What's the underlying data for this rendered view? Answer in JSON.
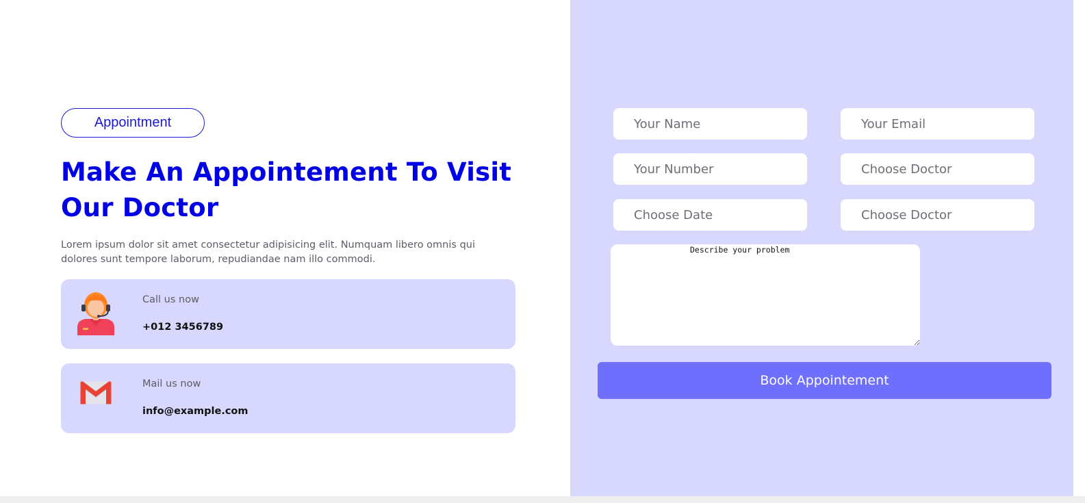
{
  "section_label": "Appointment",
  "heading": "Make An Appointement To Visit Our Doctor",
  "description": "Lorem ipsum dolor sit amet consectetur adipisicing elit. Numquam libero omnis qui dolores sunt tempore laborum, repudiandae nam illo commodi.",
  "contacts": {
    "call": {
      "icon": "support-agent-icon",
      "label": "Call us now",
      "value": "+012 3456789"
    },
    "mail": {
      "icon": "gmail-icon",
      "label": "Mail us now",
      "value": "info@example.com"
    }
  },
  "form": {
    "name_placeholder": "Your Name",
    "email_placeholder": "Your Email",
    "number_placeholder": "Your Number",
    "doctor_placeholder": "Choose Doctor",
    "date_placeholder": "Choose Date",
    "doctor2_placeholder": "Choose Doctor",
    "problem_placeholder": "Describe your problem",
    "submit_label": "Book Appointement"
  },
  "colors": {
    "accent": "#0000e6",
    "panel": "#d8d8fe",
    "button": "#6f6ffe"
  }
}
